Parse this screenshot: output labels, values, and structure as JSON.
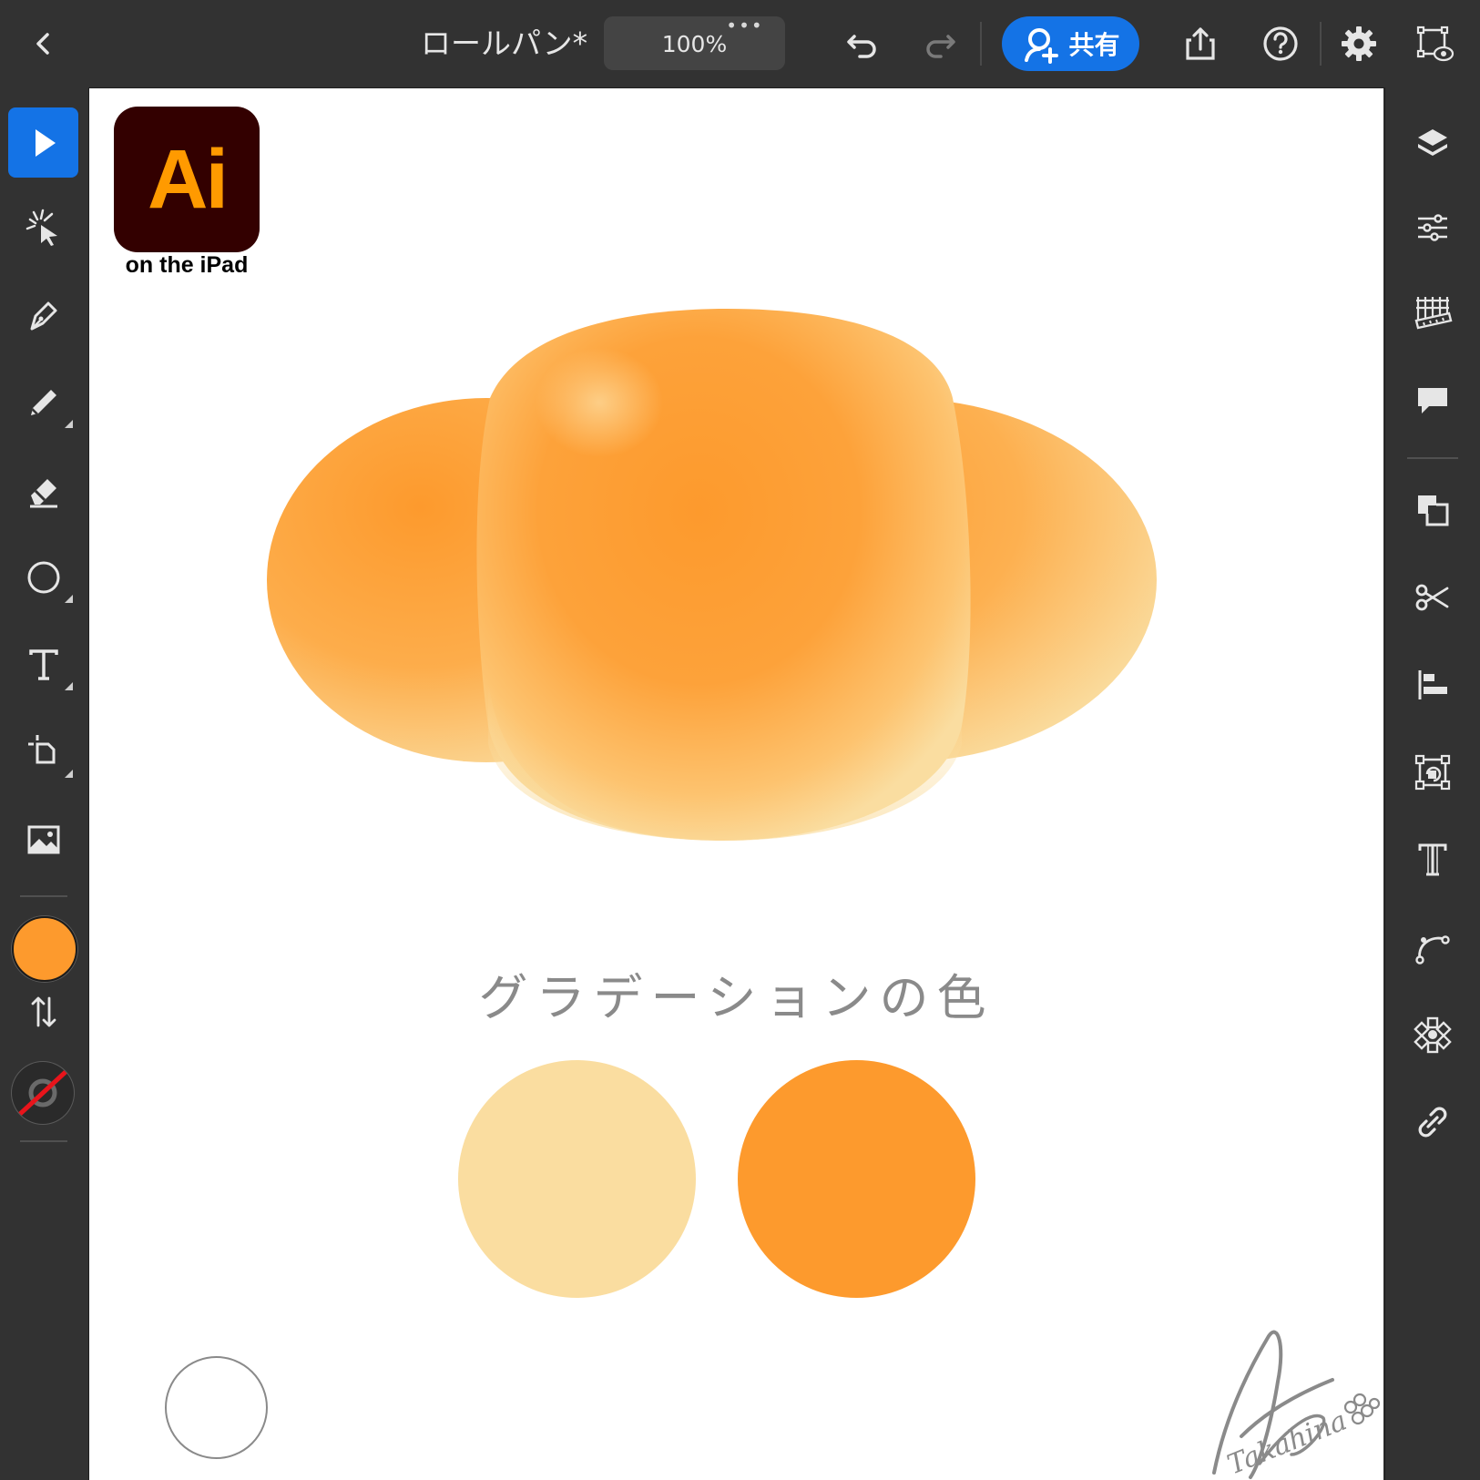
{
  "topbar": {
    "document_title": "ロールパン*",
    "zoom_label": "100%",
    "zoom_menu_dots": "•••",
    "share_label": "共有"
  },
  "canvas": {
    "logo_text": "Ai",
    "logo_subtitle": "on the iPad",
    "caption": "グラデーションの色",
    "signature_text": "Takahina"
  },
  "colors": {
    "fill": "#fd9a2d",
    "gradient_light": "#fadda0",
    "gradient_dark": "#fd9a2d",
    "accent": "#1473e6"
  },
  "left_tools": [
    {
      "icon": "selection-arrow-icon"
    },
    {
      "icon": "direct-selection-icon"
    },
    {
      "icon": "pen-icon"
    },
    {
      "icon": "pencil-icon"
    },
    {
      "icon": "eraser-icon"
    },
    {
      "icon": "ellipse-icon"
    },
    {
      "icon": "type-icon"
    },
    {
      "icon": "transform-icon"
    },
    {
      "icon": "image-icon"
    }
  ],
  "right_tools": [
    {
      "icon": "layers-icon"
    },
    {
      "icon": "properties-icon"
    },
    {
      "icon": "grid-ruler-icon"
    },
    {
      "icon": "comment-icon"
    },
    {
      "icon": "pathfinder-icon"
    },
    {
      "icon": "scissors-icon"
    },
    {
      "icon": "align-icon"
    },
    {
      "icon": "transform-icon"
    },
    {
      "icon": "type-icon"
    },
    {
      "icon": "path-icon"
    },
    {
      "icon": "repeat-icon"
    },
    {
      "icon": "link-icon"
    }
  ]
}
